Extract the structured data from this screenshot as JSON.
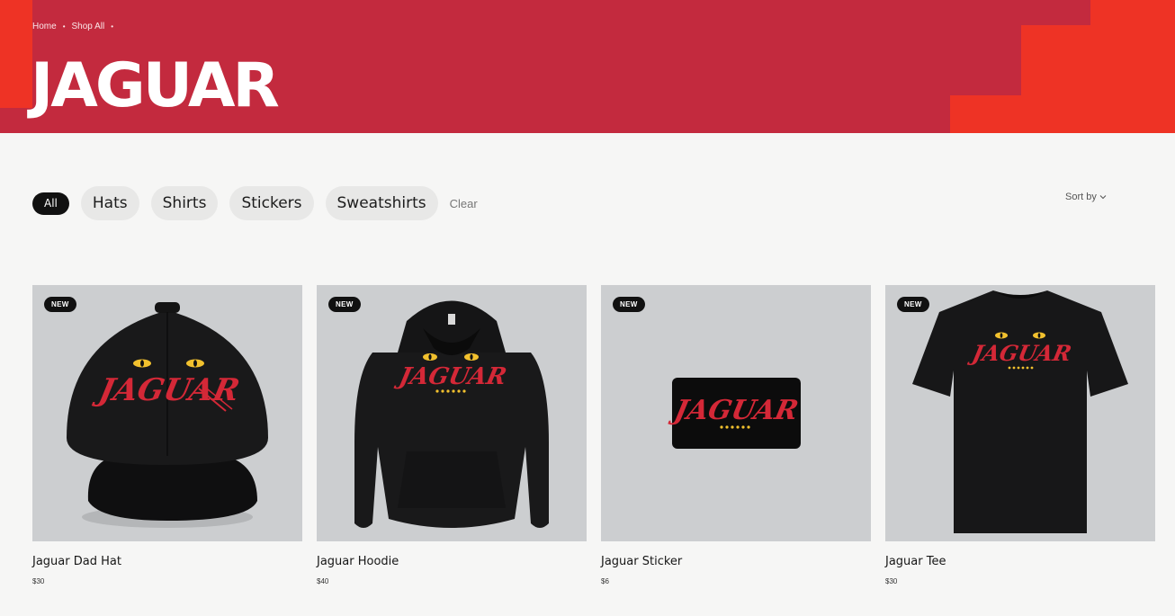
{
  "breadcrumb": {
    "home": "Home",
    "shop_all": "Shop All"
  },
  "page_title": "JAGUAR",
  "filters": {
    "all": "All",
    "hats": "Hats",
    "shirts": "Shirts",
    "stickers": "Stickers",
    "sweatshirts": "Sweatshirts",
    "clear": "Clear"
  },
  "sort_label": "Sort by",
  "colors": {
    "hero": "#c32a3e",
    "hero_accent": "#ee3325",
    "brand_red": "#d42837",
    "eye_yellow": "#f2c12e",
    "product_bg": "#ccced0"
  },
  "products": [
    {
      "badge": "NEW",
      "name": "Jaguar Dad Hat",
      "price": "$30",
      "icon": "dad-hat-image"
    },
    {
      "badge": "NEW",
      "name": "Jaguar Hoodie",
      "price": "$40",
      "icon": "hoodie-image"
    },
    {
      "badge": "NEW",
      "name": "Jaguar Sticker",
      "price": "$6",
      "icon": "sticker-image"
    },
    {
      "badge": "NEW",
      "name": "Jaguar Tee",
      "price": "$30",
      "icon": "tee-image"
    }
  ],
  "logo_text": "JAGUAR"
}
